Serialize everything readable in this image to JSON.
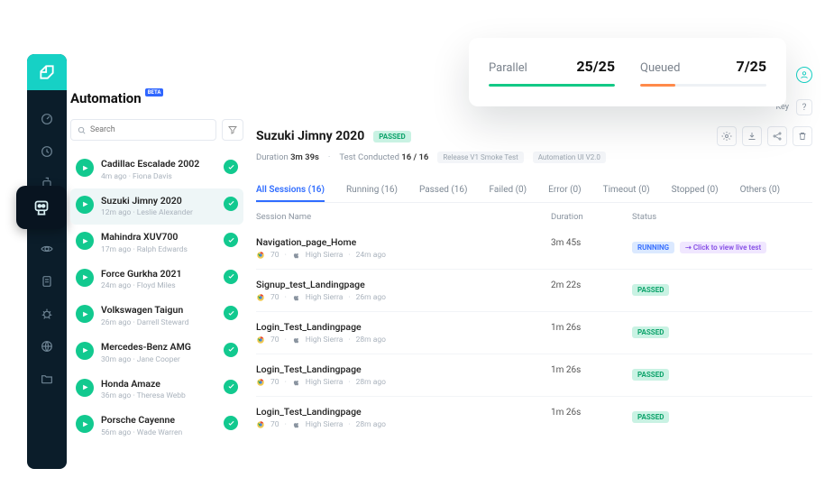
{
  "page_title": "Automation",
  "beta_label": "BETA",
  "search_placeholder": "Search",
  "header_buttons": {
    "key": "Key",
    "help": "?"
  },
  "floating": {
    "parallel_label": "Parallel",
    "parallel_value": "25/25",
    "queued_label": "Queued",
    "queued_value": "7/25"
  },
  "builds": [
    {
      "name": "Cadillac Escalade 2002",
      "meta": "4m ago  ·  Fiona Davis"
    },
    {
      "name": "Suzuki Jimny 2020",
      "meta": "12m ago  ·  Leslie Alexander",
      "selected": true
    },
    {
      "name": "Mahindra XUV700",
      "meta": "17m ago  ·  Ralph Edwards"
    },
    {
      "name": "Force Gurkha 2021",
      "meta": "24m ago  ·  Floyd Miles"
    },
    {
      "name": "Volkswagen Taigun",
      "meta": "26m ago  ·  Darrell Steward"
    },
    {
      "name": "Mercedes-Benz AMG",
      "meta": "30m ago  ·  Jane Cooper"
    },
    {
      "name": "Honda Amaze",
      "meta": "36m ago  ·  Theresa Webb"
    },
    {
      "name": "Porsche Cayenne",
      "meta": "56m ago  ·  Wade Warren"
    }
  ],
  "detail": {
    "title": "Suzuki Jimny 2020",
    "status_chip": "PASSED",
    "duration_label": "Duration",
    "duration": "3m 39s",
    "tests_label": "Test Conducted",
    "tests": "16 / 16",
    "tags": [
      "Release V1 Smoke Test",
      "Automation UI V2.0"
    ]
  },
  "tabs": [
    {
      "label": "All Sessions (16)",
      "active": true
    },
    {
      "label": "Running (16)"
    },
    {
      "label": "Passed (16)"
    },
    {
      "label": "Failed (0)"
    },
    {
      "label": "Error (0)"
    },
    {
      "label": "Timeout (0)"
    },
    {
      "label": "Stopped (0)"
    },
    {
      "label": "Others (0)"
    }
  ],
  "table": {
    "headers": {
      "name": "Session Name",
      "duration": "Duration",
      "status": "Status"
    },
    "rows": [
      {
        "name": "Navigation_page_Home",
        "ver": "70",
        "os": "High Sierra",
        "ago": "24m ago",
        "dur": "3m 45s",
        "status": "RUNNING",
        "live": "Click to view live test"
      },
      {
        "name": "Signup_test_Landingpage",
        "ver": "70",
        "os": "High Sierra",
        "ago": "26m ago",
        "dur": "2m 22s",
        "status": "PASSED"
      },
      {
        "name": "Login_Test_Landingpage",
        "ver": "70",
        "os": "High Sierra",
        "ago": "28m ago",
        "dur": "1m 26s",
        "status": "PASSED"
      },
      {
        "name": "Login_Test_Landingpage",
        "ver": "70",
        "os": "High Sierra",
        "ago": "28m ago",
        "dur": "1m 26s",
        "status": "PASSED"
      },
      {
        "name": "Login_Test_Landingpage",
        "ver": "70",
        "os": "High Sierra",
        "ago": "28m ago",
        "dur": "1m 26s",
        "status": "PASSED"
      }
    ]
  },
  "live_prefix": "⇢"
}
